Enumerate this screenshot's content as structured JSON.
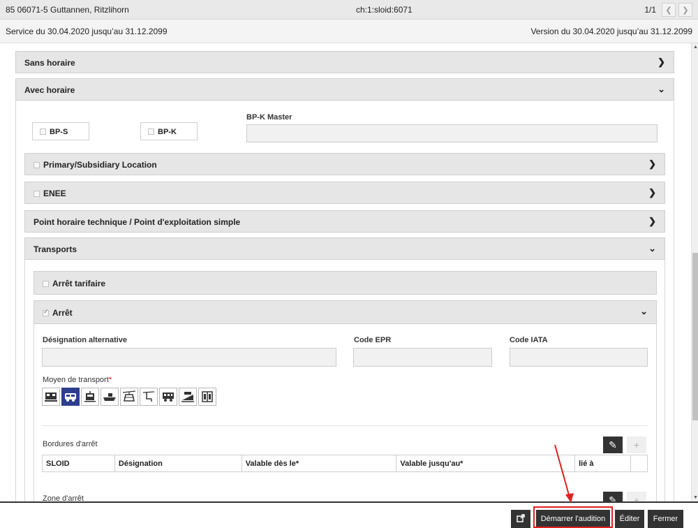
{
  "header": {
    "location": "85 06071-5 Guttannen, Ritzlihorn",
    "sloid": "ch:1:sloid:6071",
    "pager": "1/1"
  },
  "subheader": {
    "service": "Service du 30.04.2020 jusqu’au 31.12.2099",
    "version": "Version du 30.04.2020 jusqu’au 31.12.2099"
  },
  "sections": {
    "sans_horaire": "Sans horaire",
    "avec_horaire": "Avec horaire",
    "bps_label": "BP-S",
    "bpk_label": "BP-K",
    "bpk_master_label": "BP-K Master",
    "primary_location": "Primary/Subsidiary Location",
    "enee": "ENEE",
    "point_horaire": "Point horaire technique / Point d'exploitation simple",
    "transports": "Transports",
    "arret_tarifaire": "Arrêt tarifaire",
    "arret": "Arrêt"
  },
  "arret_form": {
    "designation_alternative_label": "Désignation alternative",
    "code_epr_label": "Code EPR",
    "code_iata_label": "Code IATA",
    "moyen_transport_label": "Moyen de transport",
    "required_mark": "*",
    "bordures_label": "Bordures d'arrêt",
    "zone_label": "Zone d'arrêt"
  },
  "transport_icons": [
    "train-icon",
    "bus-icon",
    "tram-icon",
    "ship-icon",
    "cable-car-icon",
    "chairlift-icon",
    "rack-railway-icon",
    "funicular-icon",
    "elevator-icon"
  ],
  "table": {
    "columns": [
      "SLOID",
      "Désignation",
      "Valable dès le*",
      "Valable jusqu'au*",
      "lié à",
      ""
    ]
  },
  "footer": {
    "export_icon": "export-icon",
    "start_audition": "Démarrer l'audition",
    "edit": "Éditer",
    "close": "Fermer"
  },
  "colors": {
    "active_transport": "#2d3e8f",
    "highlight": "#e02020",
    "dark_button": "#333333"
  }
}
